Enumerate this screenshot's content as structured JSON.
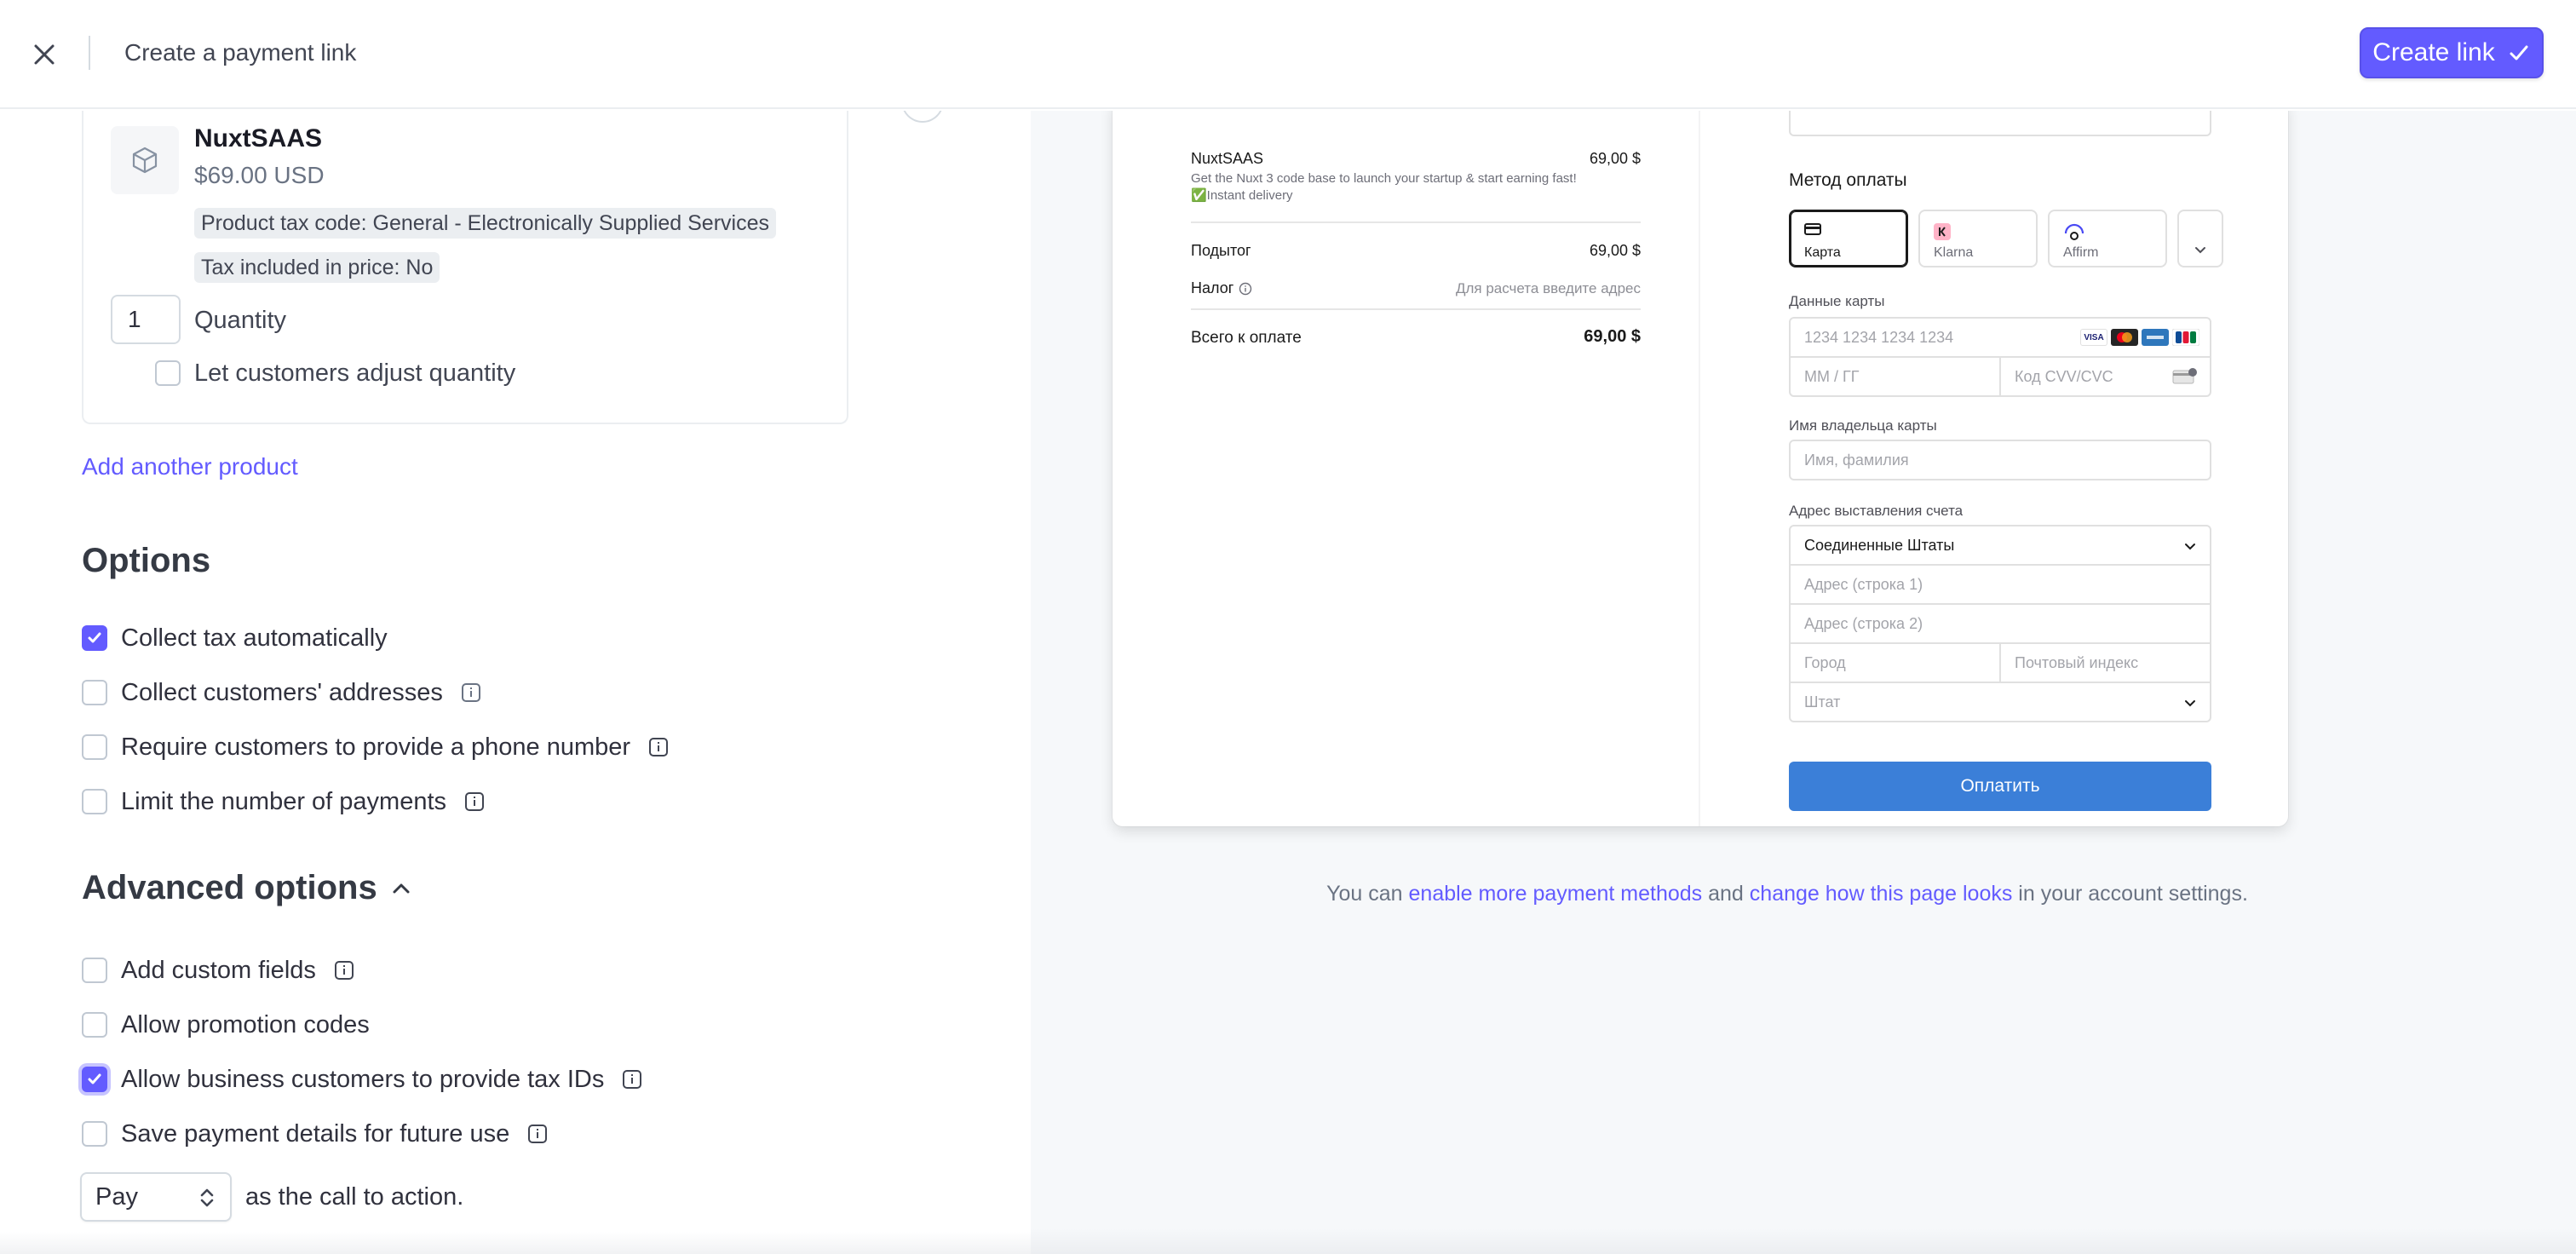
{
  "header": {
    "title": "Create a payment link",
    "create_label": "Create link"
  },
  "product": {
    "name": "NuxtSAAS",
    "price": "$69.00 USD",
    "tax_code_tag": "Product tax code: General - Electronically Supplied Services",
    "tax_included_tag": "Tax included in price: No",
    "quantity": "1",
    "quantity_label": "Quantity",
    "adjust_label": "Let customers adjust quantity",
    "add_another": "Add another product"
  },
  "options": {
    "title": "Options",
    "items": [
      {
        "label": "Collect tax automatically",
        "checked": true
      },
      {
        "label": "Collect customers' addresses",
        "checked": false
      },
      {
        "label": "Require customers to provide a phone number",
        "checked": false
      },
      {
        "label": "Limit the number of payments",
        "checked": false
      }
    ]
  },
  "advanced": {
    "title": "Advanced options",
    "items": [
      {
        "label": "Add custom fields",
        "checked": false
      },
      {
        "label": "Allow promotion codes",
        "checked": false
      },
      {
        "label": "Allow business customers to provide tax IDs",
        "checked": true
      },
      {
        "label": "Save payment details for future use",
        "checked": false
      }
    ],
    "cta_value": "Pay",
    "cta_suffix": "as the call to action."
  },
  "preview": {
    "summary": {
      "item_name": "NuxtSAAS",
      "item_price": "69,00 $",
      "item_desc": "Get the Nuxt 3 code base to launch your startup & start earning fast! ✅Instant delivery",
      "subtotal_label": "Подытог",
      "subtotal_value": "69,00 $",
      "tax_label": "Налог",
      "tax_value": "Для расчета введите адрес",
      "total_label": "Всего к оплате",
      "total_value": "69,00 $"
    },
    "form": {
      "payment_method_heading": "Метод оплаты",
      "methods": [
        {
          "label": "Карта",
          "active": true
        },
        {
          "label": "Klarna",
          "active": false
        },
        {
          "label": "Affirm",
          "active": false
        }
      ],
      "card_label": "Данные карты",
      "card_number_placeholder": "1234 1234 1234 1234",
      "expiry_placeholder": "ММ / ГГ",
      "cvc_placeholder": "Код CVV/CVC",
      "cardholder_label": "Имя владельца карты",
      "cardholder_placeholder": "Имя, фамилия",
      "billing_label": "Адрес выставления счета",
      "country_value": "Соединенные Штаты",
      "address1_placeholder": "Адрес (строка 1)",
      "address2_placeholder": "Адрес (строка 2)",
      "city_placeholder": "Город",
      "zip_placeholder": "Почтовый индекс",
      "state_placeholder": "Штат",
      "pay_label": "Оплатить",
      "card_brand_visa": "VISA"
    },
    "footer": {
      "prefix": "You can",
      "link1": "enable more payment methods",
      "middle": "and",
      "link2": "change how this page looks",
      "suffix": "in your account settings."
    }
  },
  "colors": {
    "accent": "#635bff",
    "pay_button": "#3b7fd8"
  }
}
